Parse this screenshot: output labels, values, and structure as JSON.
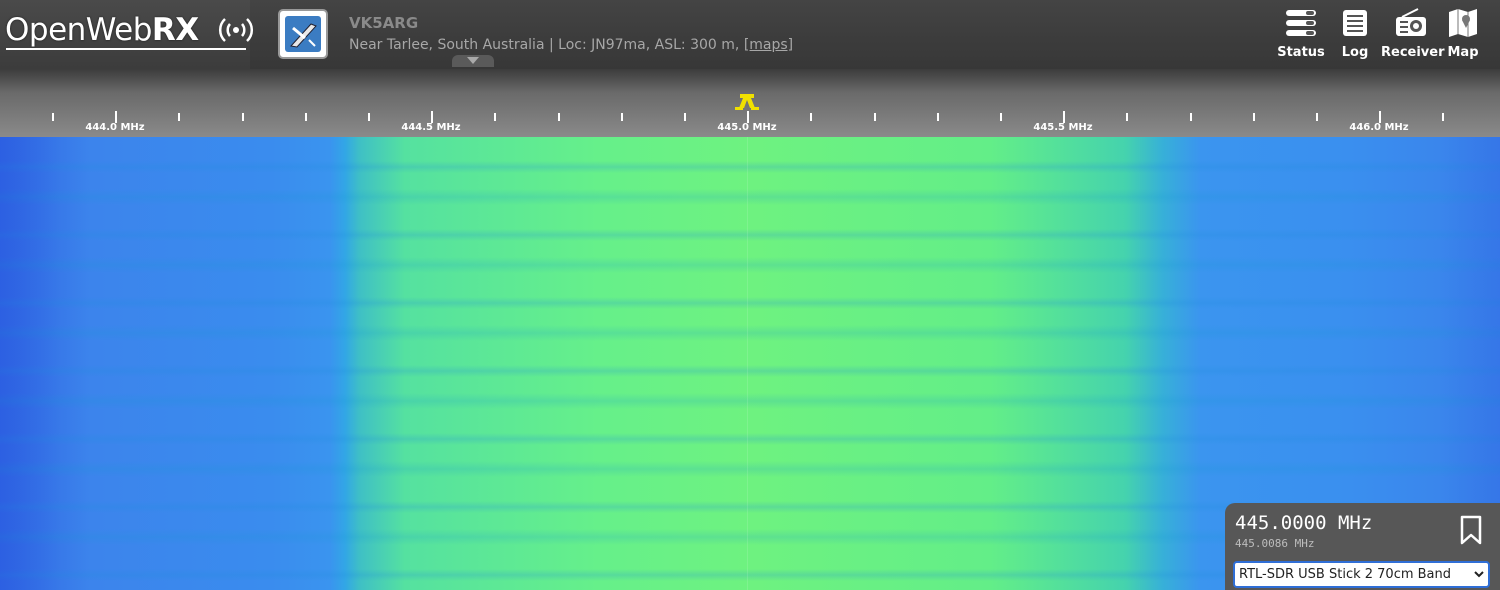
{
  "header": {
    "logo_text": "OpenWeb",
    "logo_bold": "RX",
    "receiver_name": "VK5ARG",
    "receiver_location": "Near Tarlee, South Australia",
    "receiver_details": " | Loc: JN97ma, ASL: 300 m, ",
    "maps_link": "[maps]",
    "nav": [
      {
        "label": "Status",
        "icon": "status-icon"
      },
      {
        "label": "Log",
        "icon": "log-icon"
      },
      {
        "label": "Receiver",
        "icon": "receiver-icon"
      },
      {
        "label": "Map",
        "icon": "map-icon"
      }
    ]
  },
  "scale": {
    "labels": [
      "444.0 MHz",
      "444.5 MHz",
      "445.0 MHz",
      "445.5 MHz",
      "446.0 MHz"
    ]
  },
  "frequency": {
    "main": "445.0000 MHz",
    "offset": "445.0086 MHz",
    "profile": "RTL-SDR USB Stick 2 70cm Band"
  },
  "colors": {
    "marker": "#f0e000",
    "panel": "#575757",
    "select_border": "#2f6ed6"
  }
}
